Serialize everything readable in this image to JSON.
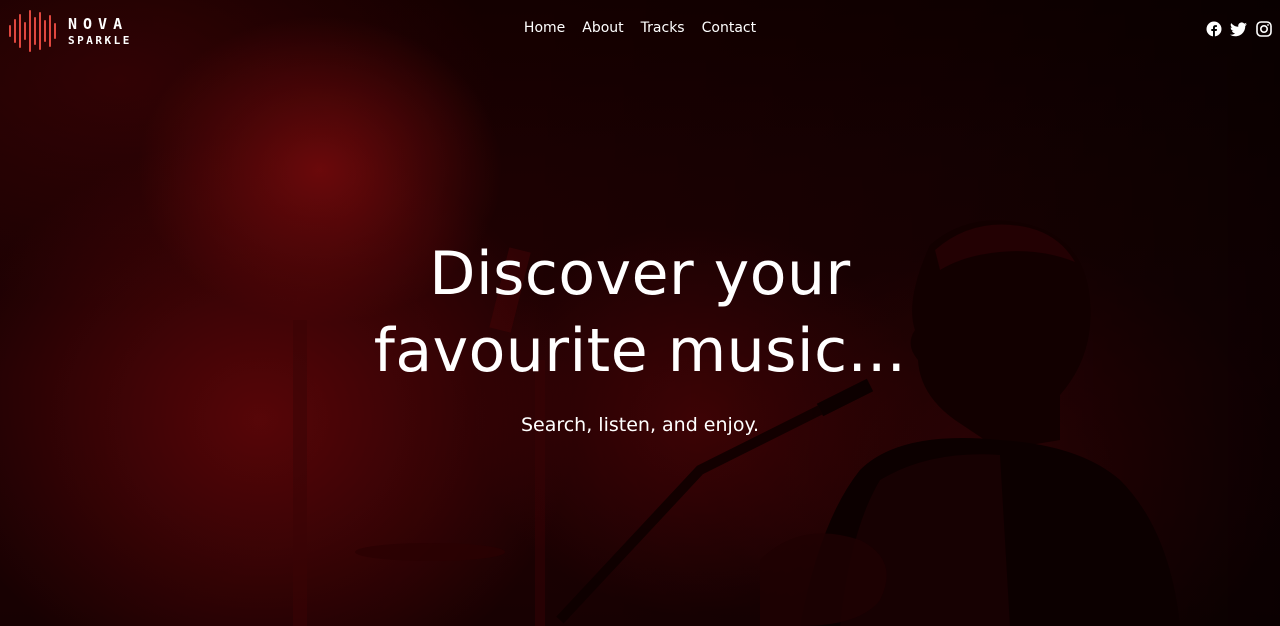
{
  "brand": {
    "name_top": "NOVA",
    "name_bottom": "SPARKLE",
    "accent_color": "#e0473f",
    "logo_icon": "sound-wave-icon"
  },
  "nav": {
    "items": [
      {
        "label": "Home"
      },
      {
        "label": "About"
      },
      {
        "label": "Tracks"
      },
      {
        "label": "Contact"
      }
    ]
  },
  "socials": [
    {
      "icon": "facebook-icon"
    },
    {
      "icon": "twitter-icon"
    },
    {
      "icon": "instagram-icon"
    }
  ],
  "hero": {
    "title_line1": "Discover your",
    "title_line2": "favourite music...",
    "subtitle": "Search, listen, and enjoy.",
    "background_tint": "#3a0204"
  }
}
